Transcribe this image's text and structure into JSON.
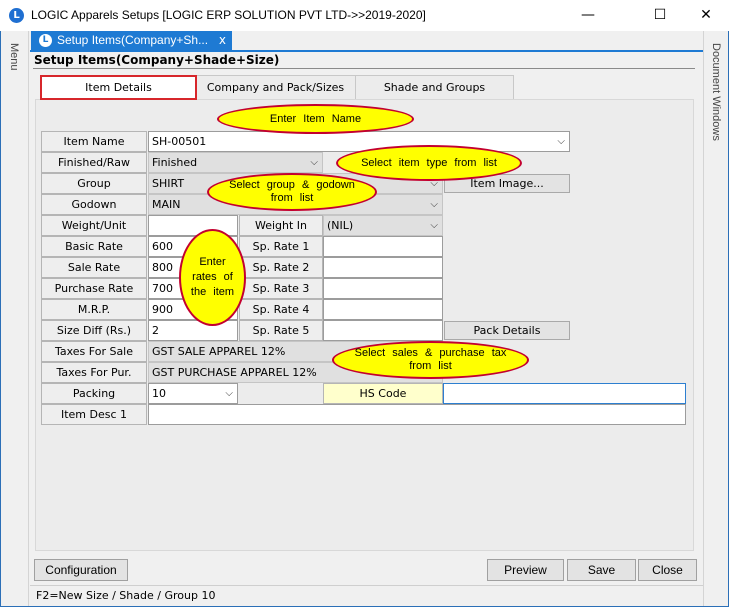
{
  "window": {
    "title": "LOGIC Apparels Setups  [LOGIC ERP SOLUTION PVT LTD->>2019-2020]",
    "app_icon": "L",
    "minimize": "—",
    "maximize": "☐",
    "close": "✕"
  },
  "side": {
    "left_label": "Menu",
    "right_label": "Document Windows"
  },
  "doc_tab": {
    "label": "Setup Items(Company+Sh...",
    "close": "x"
  },
  "form_title": "Setup Items(Company+Shade+Size)",
  "tabs": [
    {
      "label": "Item Details"
    },
    {
      "label": "Company and Pack/Sizes"
    },
    {
      "label": "Shade and Groups"
    }
  ],
  "labels": {
    "item_name": "Item Name",
    "finished_raw": "Finished/Raw",
    "group": "Group",
    "godown": "Godown",
    "weight_unit": "Weight/Unit",
    "basic_rate": "Basic Rate",
    "sale_rate": "Sale Rate",
    "purchase_rate": "Purchase Rate",
    "mrp": "M.R.P.",
    "size_diff": "Size Diff (Rs.)",
    "taxes_sale": "Taxes For Sale",
    "taxes_pur": "Taxes For Pur.",
    "packing": "Packing",
    "item_desc": "Item Desc 1",
    "weight_in": "Weight In",
    "sp_rate_1": "Sp. Rate 1",
    "sp_rate_2": "Sp. Rate 2",
    "sp_rate_3": "Sp. Rate 3",
    "sp_rate_4": "Sp. Rate 4",
    "sp_rate_5": "Sp. Rate 5",
    "hs_code": "HS Code"
  },
  "values": {
    "item_name": "SH-00501",
    "finished_raw": "Finished",
    "group": "SHIRT",
    "godown": "MAIN",
    "weight_unit": "",
    "weight_in": "(NIL)",
    "basic_rate": "600",
    "sale_rate": "800",
    "purchase_rate": "700",
    "mrp": "900",
    "size_diff": "2",
    "taxes_sale": "GST SALE APPAREL 12%",
    "taxes_pur": "GST PURCHASE APPAREL 12%",
    "packing": "10",
    "hs_code": "",
    "item_desc": ""
  },
  "buttons": {
    "item_image": "Item Image...",
    "pack_details": "Pack Details",
    "configuration": "Configuration",
    "preview": "Preview",
    "save": "Save",
    "close": "Close"
  },
  "callouts": {
    "item_name": "Enter  Item  Name",
    "item_type": "Select  item  type  from list",
    "group_godown": "Select  group  &  godown  from  list",
    "rates": "Enter rates  of the  item",
    "taxes": "Select  sales  &  purchase tax  from  list"
  },
  "status": "F2=New Size / Shade / Group 10",
  "dropdown_glyph": "⌵",
  "icons": {
    "dropdown": "chevron-down-icon",
    "app": "logic-logo-icon"
  },
  "colors": {
    "accent": "#1e7ad3",
    "callout_fill": "#ffff00",
    "callout_border": "#c3002f",
    "active_tab_border": "#d7262b"
  }
}
